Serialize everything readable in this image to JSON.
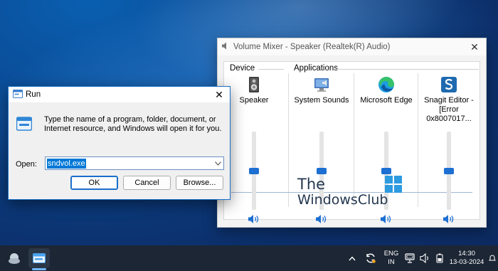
{
  "mixer": {
    "title": "Volume Mixer - Speaker (Realtek(R) Audio)",
    "close_glyph": "✕",
    "device_label": "Device",
    "applications_label": "Applications",
    "channels": [
      {
        "label": "Speaker",
        "icon": "speaker-device-icon",
        "volume_fraction": 0.5
      },
      {
        "label": "System Sounds",
        "icon": "system-sounds-icon",
        "volume_fraction": 0.5
      },
      {
        "label": "Microsoft Edge",
        "icon": "edge-icon",
        "volume_fraction": 0.5
      },
      {
        "label": "Snagit Editor - [Error 0x8007017...",
        "icon": "snagit-icon",
        "volume_fraction": 0.5
      }
    ]
  },
  "run": {
    "title": "Run",
    "close_glyph": "✕",
    "description": "Type the name of a program, folder, document, or Internet resource, and Windows will open it for you.",
    "open_label": "Open:",
    "input_value": "sndvol.exe",
    "ok_label": "OK",
    "cancel_label": "Cancel",
    "browse_label": "Browse..."
  },
  "watermark": {
    "line1": "The",
    "line2": "WindowsClub"
  },
  "taskbar": {
    "language_line1": "ENG",
    "language_line2": "IN",
    "time": "14:30",
    "date": "13-03-2024"
  },
  "colors": {
    "accent": "#1d6fd1",
    "taskbar": "#1c2634"
  }
}
